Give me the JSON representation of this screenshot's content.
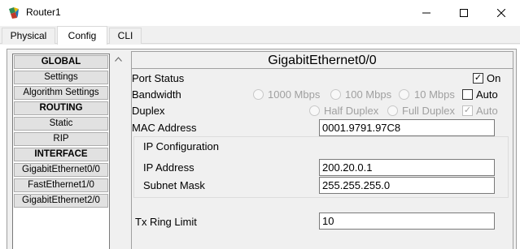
{
  "window": {
    "title": "Router1",
    "controls": {
      "minimize": "—",
      "maximize": "☐",
      "close": "✕"
    }
  },
  "tabs": [
    {
      "label": "Physical",
      "active": false
    },
    {
      "label": "Config",
      "active": true
    },
    {
      "label": "CLI",
      "active": false
    }
  ],
  "nav": {
    "items": [
      {
        "label": "GLOBAL",
        "header": true
      },
      {
        "label": "Settings",
        "header": false
      },
      {
        "label": "Algorithm Settings",
        "header": false
      },
      {
        "label": "ROUTING",
        "header": true
      },
      {
        "label": "Static",
        "header": false
      },
      {
        "label": "RIP",
        "header": false
      },
      {
        "label": "INTERFACE",
        "header": true
      },
      {
        "label": "GigabitEthernet0/0",
        "header": false
      },
      {
        "label": "FastEthernet1/0",
        "header": false
      },
      {
        "label": "GigabitEthernet2/0",
        "header": false
      }
    ],
    "scroll_up_icon": "chevron-up-icon"
  },
  "panel": {
    "title": "GigabitEthernet0/0",
    "port_status": {
      "label": "Port Status",
      "on_label": "On",
      "on_checked": true
    },
    "bandwidth": {
      "label": "Bandwidth",
      "options": [
        "1000 Mbps",
        "100 Mbps",
        "10 Mbps"
      ],
      "auto_label": "Auto",
      "auto_checked": false
    },
    "duplex": {
      "label": "Duplex",
      "options": [
        "Half Duplex",
        "Full Duplex"
      ],
      "auto_label": "Auto",
      "auto_checked": true
    },
    "mac": {
      "label": "MAC Address",
      "value": "0001.9791.97C8"
    },
    "ip_config": {
      "label": "IP Configuration",
      "ip_label": "IP Address",
      "ip_value": "200.20.0.1",
      "mask_label": "Subnet Mask",
      "mask_value": "255.255.255.0"
    },
    "tx_ring": {
      "label": "Tx Ring Limit",
      "value": "10"
    }
  }
}
